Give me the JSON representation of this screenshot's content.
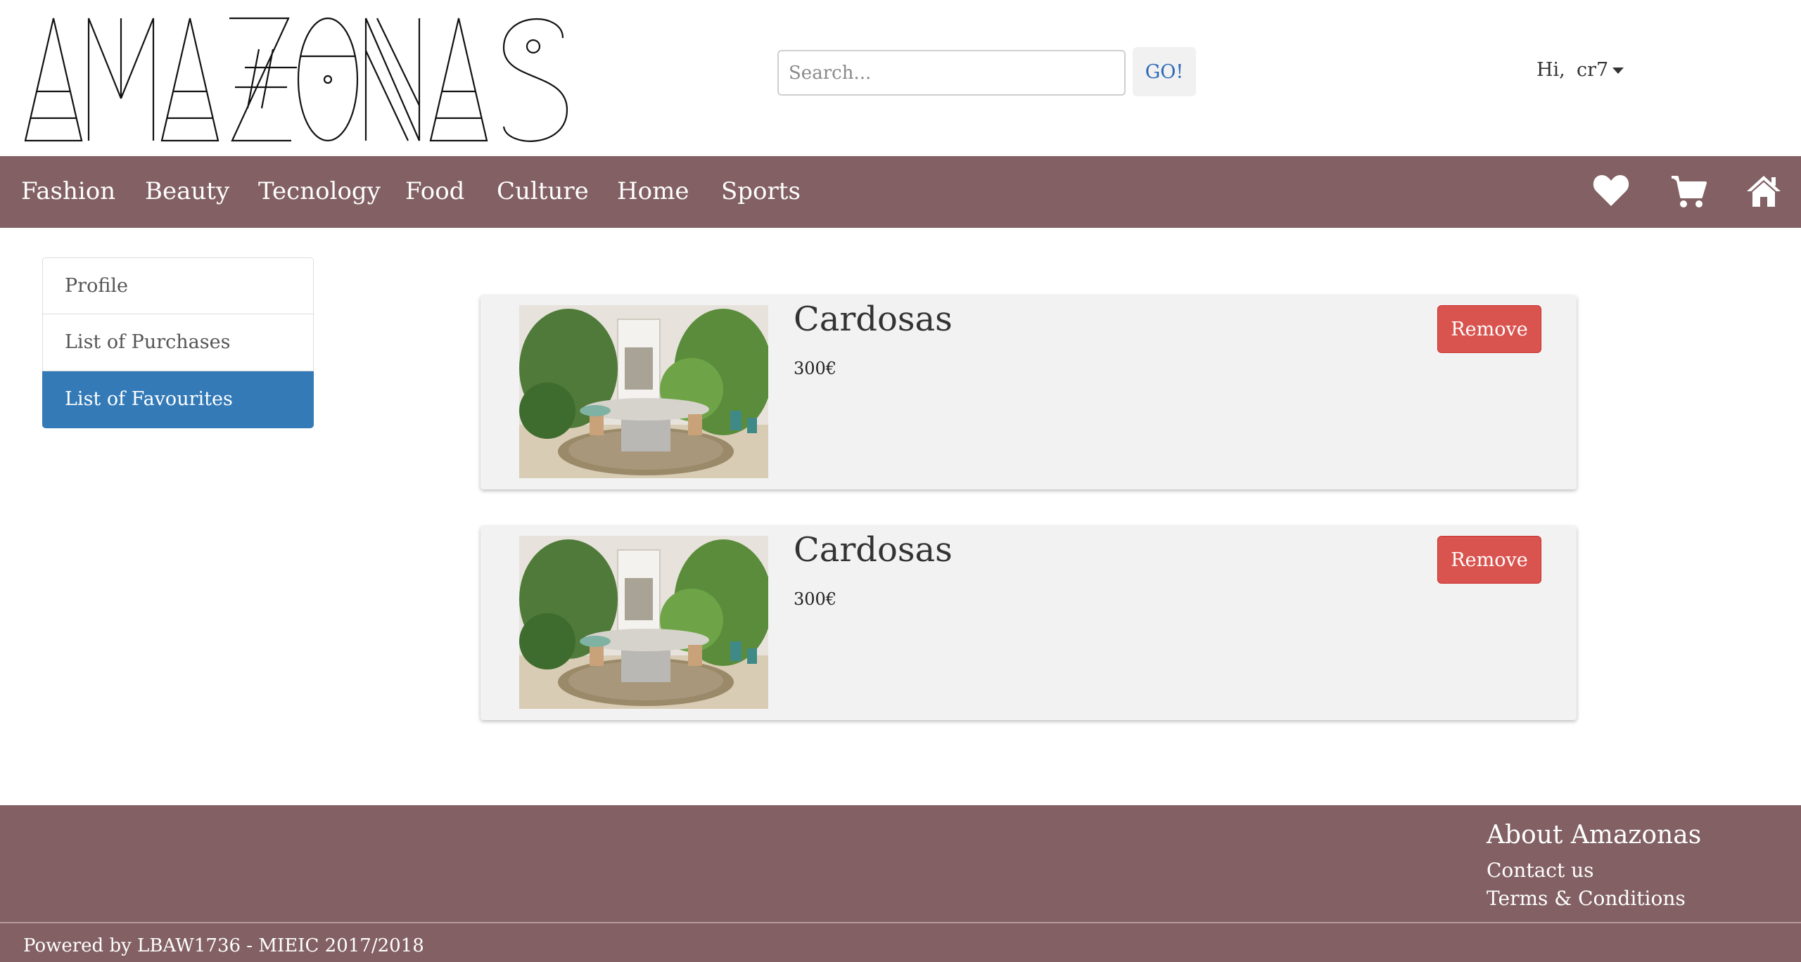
{
  "header": {
    "logo_text": "AMAZONAS",
    "search": {
      "placeholder": "Search...",
      "value": ""
    },
    "go_label": "GO!",
    "greeting": "Hi,",
    "username": "cr7"
  },
  "nav": {
    "categories": [
      "Fashion",
      "Beauty",
      "Tecnology",
      "Food",
      "Culture",
      "Home",
      "Sports"
    ],
    "icons": [
      "heart-icon",
      "cart-icon",
      "home-icon"
    ]
  },
  "sidebar": {
    "items": [
      {
        "label": "Profile",
        "active": false
      },
      {
        "label": "List of Purchases",
        "active": false
      },
      {
        "label": "List of Favourites",
        "active": true
      }
    ]
  },
  "favourites": [
    {
      "name": "Cardosas",
      "price": "300€",
      "remove_label": "Remove"
    },
    {
      "name": "Cardosas",
      "price": "300€",
      "remove_label": "Remove"
    }
  ],
  "footer": {
    "heading": "About Amazonas",
    "links": [
      "Contact us",
      "Terms & Conditions"
    ],
    "credit": "Powered by LBAW1736 - MIEIC 2017/2018"
  },
  "colors": {
    "brand": "#826063",
    "active": "#337ab7",
    "danger": "#d9534f"
  }
}
